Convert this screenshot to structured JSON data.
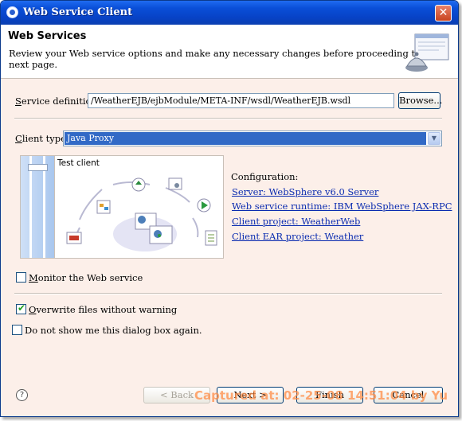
{
  "window": {
    "title": "Web Service Client",
    "close_glyph": "✕"
  },
  "banner": {
    "title": "Web Services",
    "description": "Review your Web service options and make any necessary changes before proceeding to the next page.",
    "art_icon": "web-service-wizard-icon"
  },
  "service_definition": {
    "label_pre": "S",
    "label_rest": "ervice definition:",
    "value": "/WeatherEJB/ejbModule/META-INF/wsdl/WeatherEJB.wsdl",
    "browse_label": "Browse..."
  },
  "client_type": {
    "label_pre": "C",
    "label_rest": "lient type:",
    "value": "Java Proxy",
    "arrow_glyph": "▼"
  },
  "preview": {
    "title": "Test client",
    "level": "test"
  },
  "configuration": {
    "heading": "Configuration:",
    "links": [
      {
        "text": "Server: WebSphere v6.0 Server"
      },
      {
        "text": "Web service runtime: IBM WebSphere JAX-RPC"
      },
      {
        "text": "Client project: WeatherWeb"
      },
      {
        "text": "Client EAR project: Weather"
      }
    ]
  },
  "options": {
    "monitor": {
      "pre": "M",
      "rest": "onitor the Web service",
      "checked": false
    },
    "overwrite": {
      "pre": "O",
      "rest": "verwrite files without warning",
      "checked": true
    },
    "dont_show": {
      "label": "Do not show me this dialog box again.",
      "checked": false
    }
  },
  "footer": {
    "help_glyph": "?",
    "back_label": "< Back",
    "next_label": "Next >",
    "finish_label": "Finish",
    "cancel_label": "Cancel",
    "watermark": "Captured at: 02-25-08 14:51:04 by Yu"
  },
  "colors": {
    "title_bar": "#0a4fd8",
    "selection": "#3169c6",
    "link": "#0a2bb0",
    "dialog_bg": "#fcefe9"
  }
}
